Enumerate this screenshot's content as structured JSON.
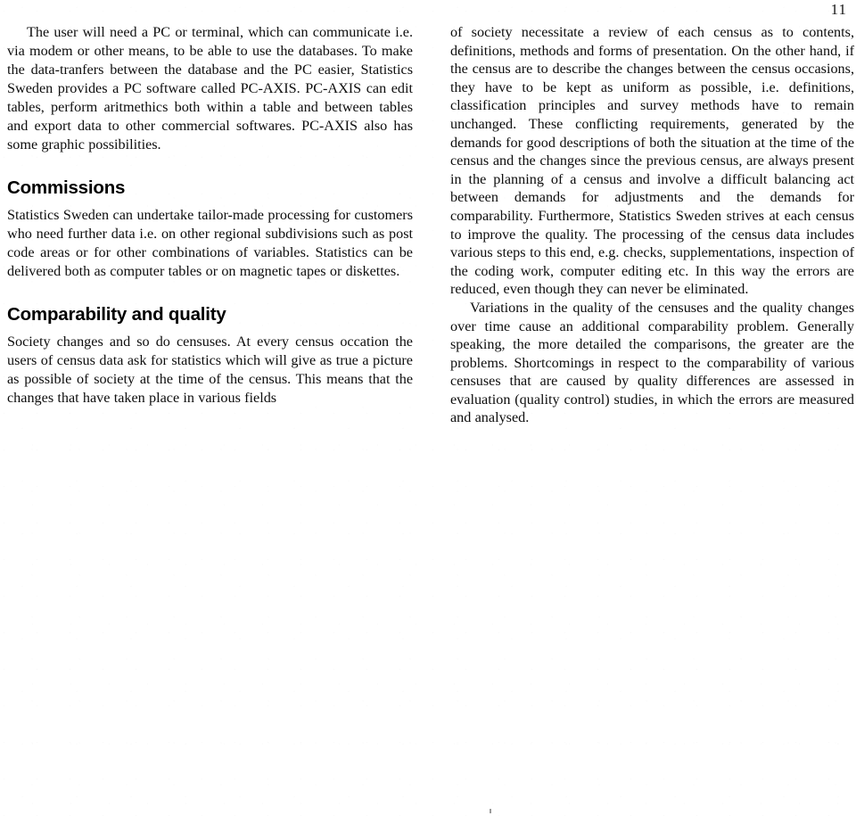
{
  "page": {
    "folio": "11",
    "background_color": "#ffffff",
    "text_color": "#0d0d0d"
  },
  "left_column": {
    "paragraphs": [
      {
        "id": "pc-axis",
        "indent": true,
        "text": "The user will need a PC or terminal, which can communicate i.e. via modem or other means, to be able to use the databases. To make the data-tranfers between the database and the PC easier, Statistics Sweden provides a PC software called PC-AXIS. PC-AXIS can edit tables, perform aritmethics both within a table and between tables and export data to other commercial softwares. PC-AXIS also has some graphic possibilities."
      }
    ],
    "sections": [
      {
        "heading": "Commissions",
        "paragraphs": [
          {
            "id": "commissions-body",
            "indent": false,
            "text": "Statistics Sweden can undertake tailor-made processing for customers who need further data i.e. on other regional subdivisions such as post code areas or for other combinations of variables. Statistics can be delivered both as computer tables or on magnetic tapes or diskettes."
          }
        ]
      },
      {
        "heading": "Comparability and quality",
        "paragraphs": [
          {
            "id": "comparability-body",
            "indent": false,
            "text": "Society changes and so do censuses. At every census occation the users of census data ask for statistics which will give as true a picture as possible of society at the time of the census. This means that  the changes that have taken place in various fields"
          }
        ]
      }
    ]
  },
  "right_column": {
    "paragraphs": [
      {
        "id": "comparability-continued",
        "indent": false,
        "text": "of society necessitate a review of each census as to contents, definitions, methods and forms of presentation. On the other hand, if the census are to describe the changes between the census occasions, they have to be kept as uniform as possible, i.e. definitions, classification principles and survey methods have to remain unchanged. These conflicting requirements, generated by the demands for good descriptions of both the situation at the time of the census and the changes since the previous census, are always present in the planning of a census and involve a difficult balancing act between demands for adjustments and the demands for comparability. Furthermore, Statistics Sweden strives at each census to improve the quality. The processing of the census data includes various steps to this end, e.g. checks, supplementations, inspection of the coding work, computer editing etc. In this way the errors are reduced, even though they can never be eliminated."
      },
      {
        "id": "quality-variations",
        "indent": true,
        "text": "Variations in the quality of the censuses and the quality changes over time cause an additional comparability problem. Generally speaking, the more detailed the comparisons, the greater are the problems. Shortcomings in respect to the comparability of various censuses that are caused by quality differences are assessed in evaluation (quality control) studies, in which the errors are measured and analysed."
      }
    ]
  }
}
